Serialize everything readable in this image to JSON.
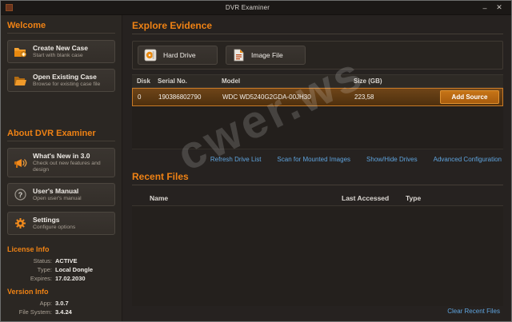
{
  "window": {
    "title": "DVR Examiner",
    "minimize_label": "–",
    "close_label": "✕"
  },
  "colors": {
    "accent_orange": "#ef8214",
    "row_highlight_border": "#c97a26",
    "link_blue": "#5fa4de"
  },
  "watermark": "cwer.ws",
  "sidebar": {
    "welcome_heading": "Welcome",
    "welcome_items": [
      {
        "label": "Create New Case",
        "sublabel": "Start with blank case",
        "icon": "folder-plus-icon"
      },
      {
        "label": "Open Existing Case",
        "sublabel": "Browse for existing case file",
        "icon": "folder-open-icon"
      }
    ],
    "about_heading": "About DVR Examiner",
    "about_items": [
      {
        "label": "What's New in 3.0",
        "sublabel": "Check out new features and design",
        "icon": "megaphone-icon"
      },
      {
        "label": "User's Manual",
        "sublabel": "Open user's manual",
        "icon": "question-icon"
      },
      {
        "label": "Settings",
        "sublabel": "Configure options",
        "icon": "gear-icon"
      }
    ],
    "license": {
      "heading": "License Info",
      "rows": [
        [
          "Status:",
          "ACTIVE"
        ],
        [
          "Type:",
          "Local Dongle"
        ],
        [
          "Expires:",
          "17.02.2030"
        ]
      ]
    },
    "version": {
      "heading": "Version Info",
      "rows": [
        [
          "App:",
          "3.0.7"
        ],
        [
          "File System:",
          "3.4.24"
        ]
      ]
    }
  },
  "main": {
    "explore_heading": "Explore Evidence",
    "source_buttons": [
      {
        "label": "Hard Drive",
        "icon": "hard-drive-icon"
      },
      {
        "label": "Image File",
        "icon": "image-file-icon"
      }
    ],
    "drives_table": {
      "headers": [
        "Disk",
        "Serial No.",
        "Model",
        "Size (GB)"
      ],
      "rows": [
        {
          "disk": "0",
          "serial": "190386802790",
          "model": "WDC WD5240G2GDA-00JH30",
          "size": "223,58",
          "action": "Add Source"
        }
      ]
    },
    "links": [
      "Refresh Drive List",
      "Scan for Mounted Images",
      "Show/Hide Drives",
      "Advanced Configuration"
    ],
    "recent_heading": "Recent Files",
    "recent_table": {
      "headers": [
        "Name",
        "Last Accessed",
        "Type"
      ]
    },
    "clear_link": "Clear Recent Files"
  }
}
